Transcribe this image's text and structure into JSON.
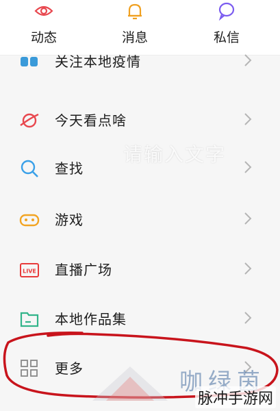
{
  "tabs": [
    {
      "label": "动态",
      "icon": "eye-icon"
    },
    {
      "label": "消息",
      "icon": "bell-icon"
    },
    {
      "label": "私信",
      "icon": "chat-bubble-icon"
    }
  ],
  "menu_items": [
    {
      "label": "关注本地疫情",
      "icon": "local-news-icon"
    },
    {
      "label": "今天看点啥",
      "icon": "planet-icon"
    },
    {
      "label": "查找",
      "icon": "search-icon"
    },
    {
      "label": "游戏",
      "icon": "gamepad-icon"
    },
    {
      "label": "直播广场",
      "icon": "live-icon"
    },
    {
      "label": "本地作品集",
      "icon": "folder-icon"
    },
    {
      "label": "更多",
      "icon": "grid-icon"
    }
  ],
  "watermark": {
    "input_hint": "请输入文字",
    "brand_cn": "咖绿茵",
    "site": "脉冲手游网"
  },
  "colors": {
    "eye": "#e8474e",
    "bell": "#f0a020",
    "chat": "#7b5cf0",
    "search": "#3aa0e8",
    "gamepad": "#f2a422",
    "live": "#e83a3a",
    "folder": "#32b48a",
    "grid": "#888888",
    "annotation": "#c8141c"
  }
}
